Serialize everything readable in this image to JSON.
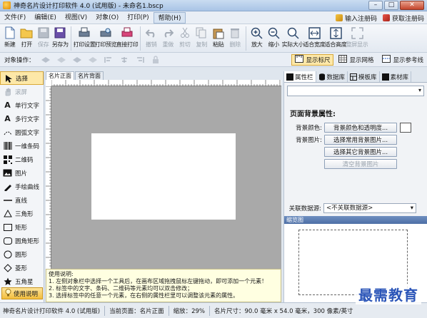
{
  "window": {
    "title": "神奇名片设计打印软件 4.0 (试用版) - 未命名1.bscp"
  },
  "menu": {
    "items": [
      "文件(F)",
      "编辑(E)",
      "视图(V)",
      "对象(O)",
      "打印(P)",
      "帮助(H)"
    ],
    "active_index": 5,
    "register_label": "输入注册码",
    "get_code_label": "获取注册码"
  },
  "toolbar": {
    "buttons": [
      {
        "label": "新建",
        "icon": "new-icon"
      },
      {
        "label": "打开",
        "icon": "open-icon"
      },
      {
        "label": "保存",
        "icon": "save-icon",
        "disabled": true
      },
      {
        "label": "另存为",
        "icon": "save-as-icon"
      },
      {
        "label": "打印设置",
        "icon": "print-setup-icon"
      },
      {
        "label": "打印预览",
        "icon": "print-preview-icon"
      },
      {
        "label": "直接打印",
        "icon": "print-icon"
      },
      {
        "label": "撤销",
        "icon": "undo-icon",
        "disabled": true
      },
      {
        "label": "重做",
        "icon": "redo-icon",
        "disabled": true
      },
      {
        "label": "剪切",
        "icon": "cut-icon",
        "disabled": true
      },
      {
        "label": "复制",
        "icon": "copy-icon",
        "disabled": true
      },
      {
        "label": "粘贴",
        "icon": "paste-icon"
      },
      {
        "label": "删除",
        "icon": "delete-icon",
        "disabled": true
      },
      {
        "label": "放大",
        "icon": "zoom-in-icon"
      },
      {
        "label": "缩小",
        "icon": "zoom-out-icon"
      },
      {
        "label": "实际大小",
        "icon": "actual-size-icon"
      },
      {
        "label": "适合宽度",
        "icon": "fit-width-icon"
      },
      {
        "label": "适合高度",
        "icon": "fit-height-icon"
      },
      {
        "label": "整屏显示",
        "icon": "fullscreen-icon",
        "disabled": true
      }
    ]
  },
  "objbar": {
    "label": "对象操作：",
    "show_ruler": "显示标尺",
    "show_grid": "显示网格",
    "show_guides": "显示参考线"
  },
  "tools": [
    {
      "label": "选择",
      "icon": "pointer-icon",
      "selected": true
    },
    {
      "label": "滚屏",
      "icon": "hand-icon",
      "disabled": true
    },
    {
      "label": "单行文字",
      "icon": "text-line-icon"
    },
    {
      "label": "多行文字",
      "icon": "text-multiline-icon"
    },
    {
      "label": "圆弧文字",
      "icon": "text-arc-icon"
    },
    {
      "label": "一维条码",
      "icon": "barcode-icon"
    },
    {
      "label": "二维码",
      "icon": "qrcode-icon"
    },
    {
      "label": "图片",
      "icon": "image-icon"
    },
    {
      "label": "手绘曲线",
      "icon": "freehand-icon"
    },
    {
      "label": "直线",
      "icon": "line-icon"
    },
    {
      "label": "三角形",
      "icon": "triangle-icon"
    },
    {
      "label": "矩形",
      "icon": "rect-icon"
    },
    {
      "label": "圆角矩形",
      "icon": "round-rect-icon"
    },
    {
      "label": "圆形",
      "icon": "circle-icon"
    },
    {
      "label": "菱形",
      "icon": "diamond-icon"
    },
    {
      "label": "五角星",
      "icon": "star-icon"
    }
  ],
  "help_button": "使用说明",
  "doc_tabs": [
    "名片正面",
    "名片背面"
  ],
  "help_text": {
    "title": "使用说明:",
    "lines": [
      "1. 左侧对象栏中选择一个工具后，在画布区域拖拽鼠标左键拖动，即可添加一个元素！",
      "2. 标签中的文字、条码、二维码等元素均可以双击修改；",
      "3. 选择标签中的任意一个元素，在右侧的属性栏里可以调整该元素的属性。"
    ]
  },
  "right_panel": {
    "tabs": [
      "属性栏",
      "数据库",
      "模板库",
      "素材库"
    ],
    "section_title": "页面背景属性:",
    "bg_color_label": "背景颜色:",
    "bg_color_button": "背景颜色和透明度...",
    "bg_image_label": "背景图片:",
    "bg_image_button_common": "选择常用背景图片...",
    "bg_image_button_other": "选择其它背景图片...",
    "clear_bg_button": "清空背景图片",
    "datasource_label": "关联数据源:",
    "datasource_value": "<不关联数据源>",
    "preview_title": "缩览图"
  },
  "status": {
    "app": "神奇名片设计打印软件 4.0 (试用版)",
    "page": "当前页面：名片正面",
    "zoom": "缩放：29%",
    "size": "名片尺寸：90.0 毫米 x 54.0 毫米，300 像素/英寸"
  },
  "watermark": "最需教育",
  "colors": {
    "accent_selection": "#fde8a8",
    "canvas_bg": "#a9a9a9",
    "watermark": "#2b55b8"
  }
}
